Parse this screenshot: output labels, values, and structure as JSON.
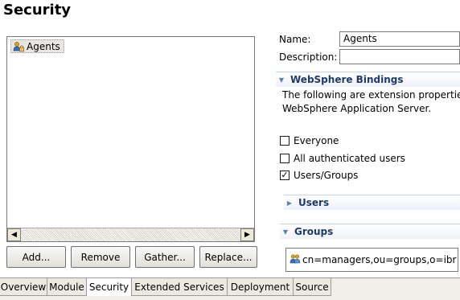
{
  "page": {
    "title": "Security"
  },
  "roles": {
    "items": [
      {
        "label": "Agents",
        "icon": "role-user-icon"
      }
    ]
  },
  "buttons": {
    "add": "Add...",
    "remove": "Remove",
    "gather": "Gather...",
    "replace": "Replace..."
  },
  "details": {
    "name_label": "Name:",
    "name_value": "Agents",
    "description_label": "Description:",
    "description_value": ""
  },
  "websphere": {
    "header": "WebSphere Bindings",
    "desc_line1": "The following are extension properties",
    "desc_line2": "WebSphere Application Server.",
    "everyone": {
      "label": "Everyone",
      "checked": false
    },
    "all_authenticated": {
      "label": "All authenticated users",
      "checked": false
    },
    "users_groups": {
      "label": "Users/Groups",
      "checked": true
    },
    "users_header": "Users",
    "groups_header": "Groups",
    "groups_item": "cn=managers,ou=groups,o=ibr"
  },
  "tabs": [
    "Overview",
    "Module",
    "Security",
    "Extended Services",
    "Deployment",
    "Source"
  ],
  "active_tab": "Security",
  "colors": {
    "section_title": "#1c3b6c",
    "tab_active": "#ffffff",
    "list_selection": "#e8e6e0"
  }
}
